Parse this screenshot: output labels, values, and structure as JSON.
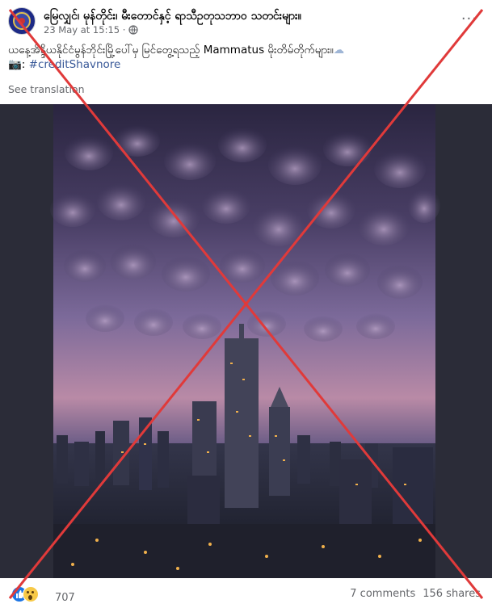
{
  "post": {
    "page_name": "မြေလျှင်၊ မုန်တိုင်း၊ မီးတောင်နှင့် ရာသီဥတုသဘာဝ သတင်းများ။",
    "timestamp": "23 May at 15:15 ·",
    "more_icon": "···",
    "caption_line1": "ယနေ့အိန္ဒိယနိုင်ငံမွန်ဘိုင်းမြို့ပေါ်မှ မြင်တွေ့ရသည့် Mammatus မိုးတိမ်တိုက်များ။",
    "caption_emoji": "☁",
    "caption_camera": "📷:",
    "caption_hashtag": "#creditShavnore",
    "see_translation": "See translation"
  },
  "footer": {
    "reaction_icons": [
      "like-icon",
      "wow-icon"
    ],
    "reaction_count": "707",
    "comments": "7 comments",
    "shares": "156 shares"
  },
  "overlay": {
    "cross_color": "#e03a3a"
  }
}
